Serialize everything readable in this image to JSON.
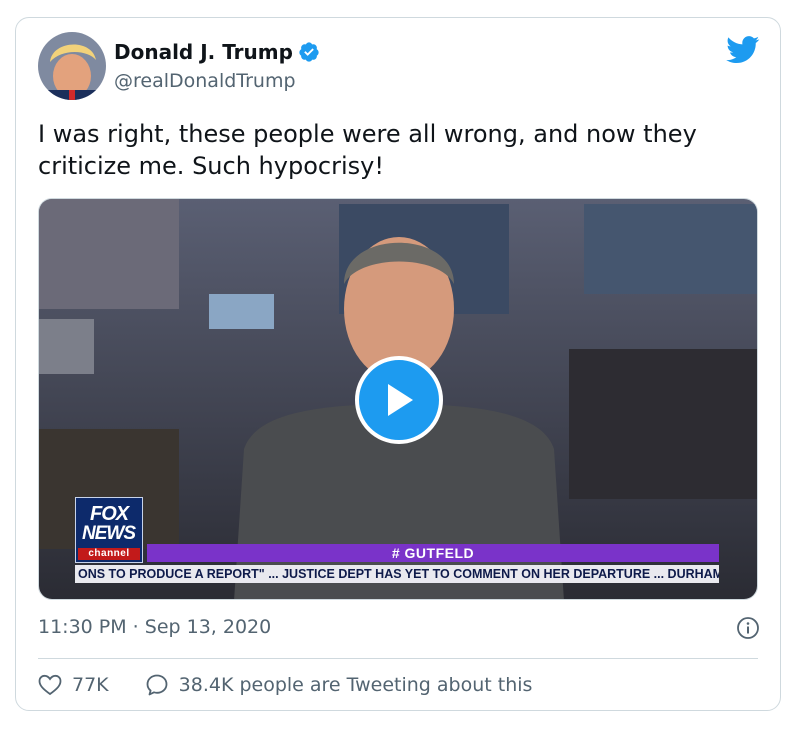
{
  "author": {
    "name": "Donald J. Trump",
    "handle": "@realDonaldTrump",
    "verified": true
  },
  "tweet": {
    "text": "I was right, these people were all wrong, and now they criticize me. Such hypocrisy!",
    "timestamp": "11:30 PM · Sep 13, 2020"
  },
  "media": {
    "type": "video",
    "chyron_tag": "# GUTFELD",
    "chyron_ticker": "ONS TO PRODUCE A REPORT\" ...   JUSTICE DEPT HAS YET TO COMMENT ON HER DEPARTURE ...   DURHAM",
    "logo_line1": "FOX",
    "logo_line2": "NEWS",
    "logo_line3": "channel"
  },
  "engagement": {
    "likes": "77K",
    "replies_label": "38.4K people are Tweeting about this"
  },
  "colors": {
    "accent": "#1d9bf0",
    "secondary_text": "#536471",
    "border": "#cfd9de"
  },
  "icons": [
    "twitter-bird-icon",
    "verified-badge-icon",
    "play-icon",
    "info-icon",
    "heart-icon",
    "reply-bubble-icon"
  ]
}
